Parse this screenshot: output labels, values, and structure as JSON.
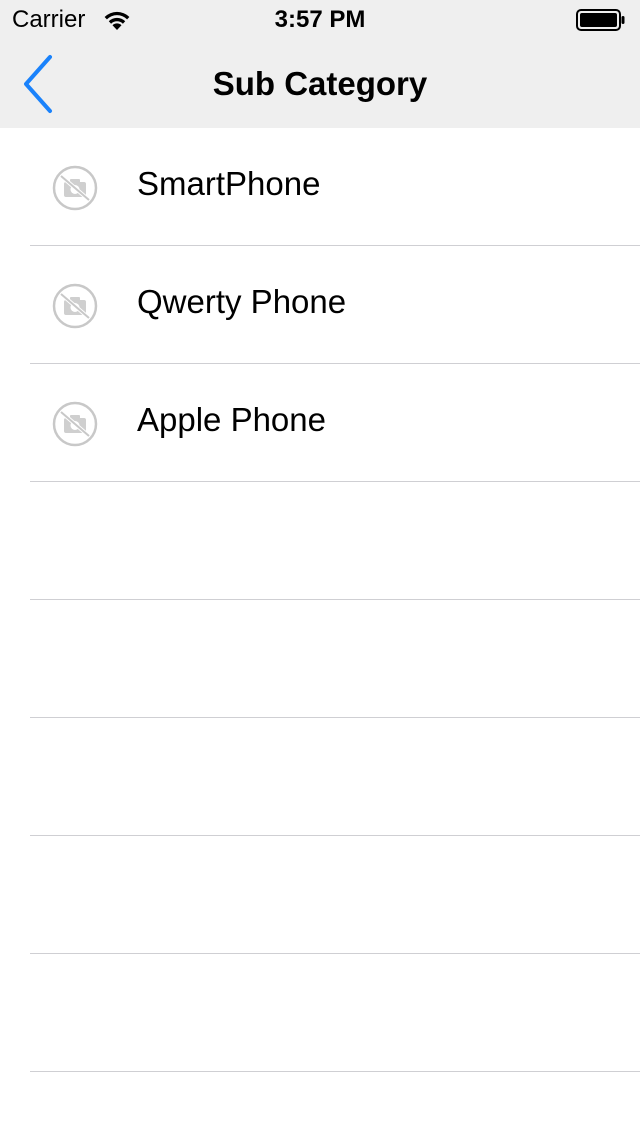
{
  "status_bar": {
    "carrier": "Carrier",
    "time": "3:57 PM",
    "wifi_icon": "wifi-icon",
    "battery_icon": "battery-full-icon"
  },
  "nav_bar": {
    "title": "Sub Category",
    "back_icon": "chevron-left-icon",
    "accent_color": "#1a82fb",
    "background_color": "#efefef"
  },
  "list": {
    "items": [
      {
        "label": "SmartPhone",
        "icon": "no-photo-icon"
      },
      {
        "label": "Qwerty Phone",
        "icon": "no-photo-icon"
      },
      {
        "label": "Apple Phone",
        "icon": "no-photo-icon"
      },
      {
        "label": ""
      },
      {
        "label": ""
      },
      {
        "label": ""
      },
      {
        "label": ""
      },
      {
        "label": ""
      }
    ],
    "separator_color": "#cfcfd3"
  }
}
